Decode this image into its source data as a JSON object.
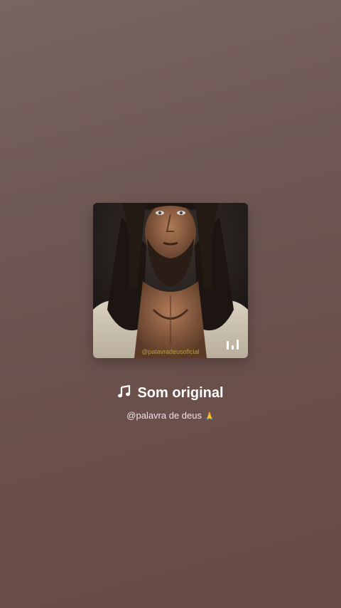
{
  "sound": {
    "title": "Som original",
    "artist": "@palavra de deus",
    "artist_emoji": "🙏",
    "cover_image": "portrait-of-long-haired-bearded-man",
    "cover_watermark": "@palavradeusoficial"
  },
  "icons": {
    "title_icon": "music-note-icon",
    "overlay_icon": "sound-playing-bars-icon"
  },
  "colors": {
    "background_top": "#7a6460",
    "background_bottom": "#684c46",
    "text_primary": "#ffffff",
    "text_secondary": "#ece4e1"
  }
}
